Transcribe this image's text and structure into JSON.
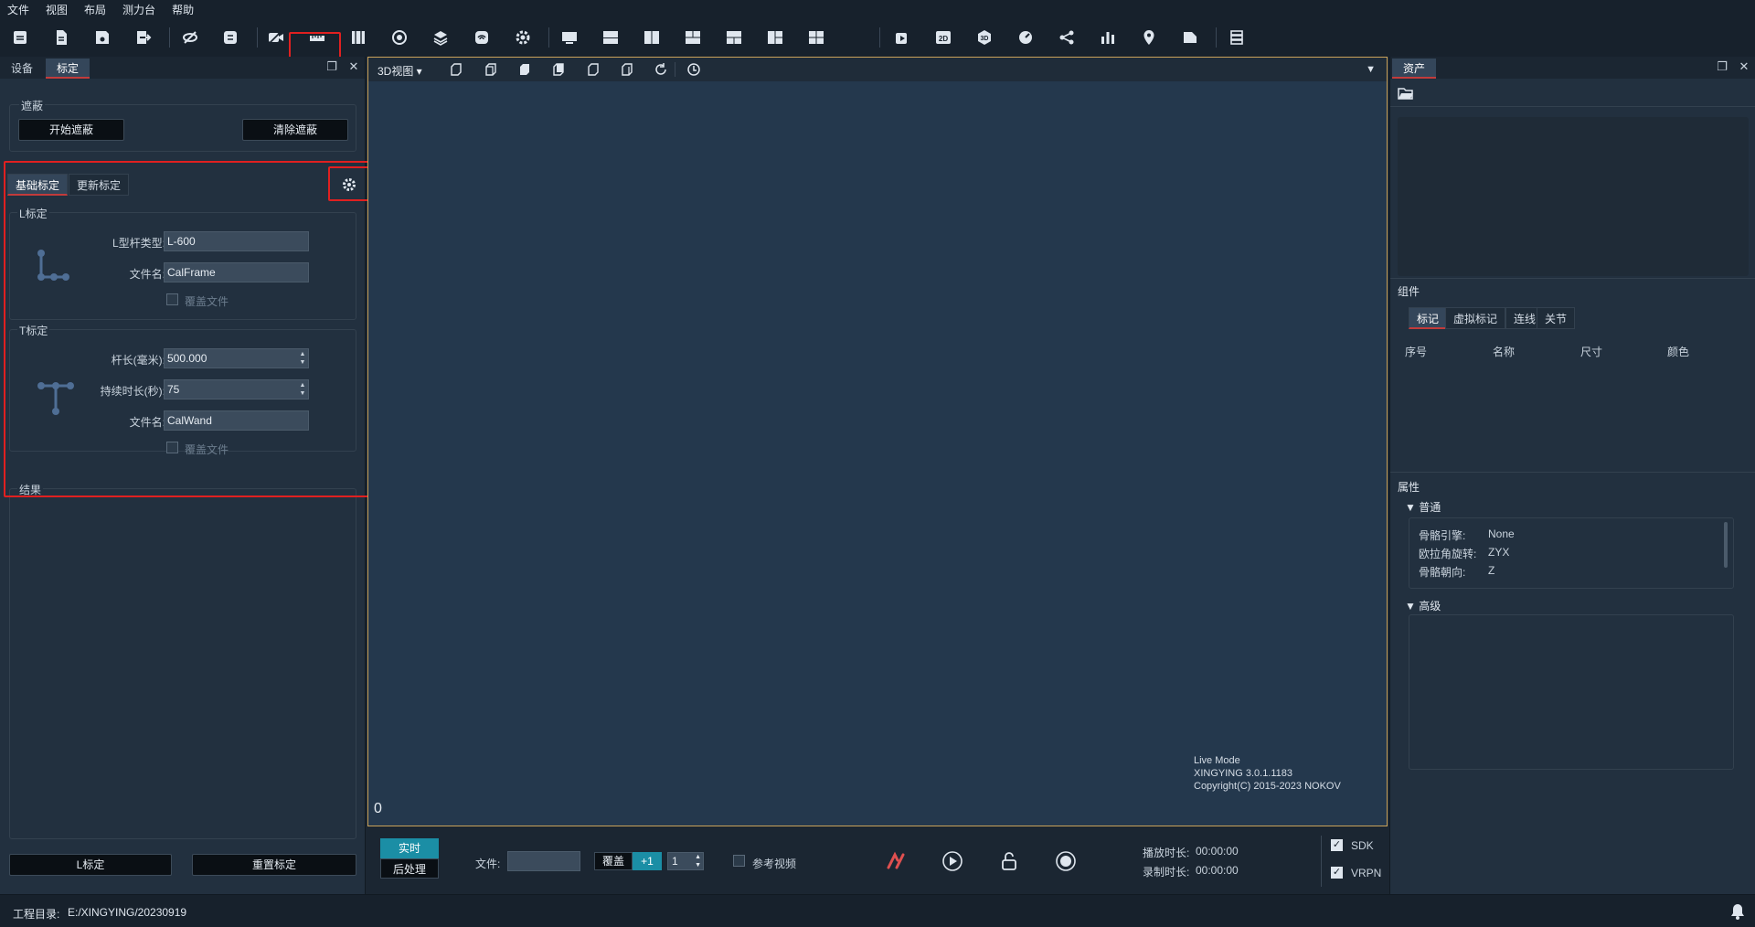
{
  "menu": [
    "文件",
    "视图",
    "布局",
    "测力台",
    "帮助"
  ],
  "toolbar_icons": [
    "open-project-icon",
    "new-file-icon",
    "save-icon",
    "export-icon",
    "hide-icon",
    "sync-icon",
    "camera-off-icon",
    "ruler-icon",
    "film-icon",
    "record-disc-icon",
    "layers-icon",
    "wireless-icon",
    "settings-icon",
    "monitor-icon",
    "layout-1-icon",
    "layout-2-icon",
    "layout-3-icon",
    "layout-4-icon",
    "layout-5-icon",
    "layout-6-icon",
    "camera-2d-icon",
    "2d-view-icon",
    "3d-view-icon",
    "gauge-icon",
    "skeleton-icon",
    "bar-chart-icon",
    "location-pin-icon",
    "document-icon",
    "list-icon"
  ],
  "left_panel": {
    "tabs": [
      "设备",
      "标定"
    ],
    "active_tab": "标定",
    "mask_group": {
      "title": "遮蔽",
      "start_button": "开始遮蔽",
      "clear_button": "清除遮蔽"
    },
    "subtabs": [
      "基础标定",
      "更新标定"
    ],
    "l_calib": {
      "title": "L标定",
      "type_label": "L型杆类型:",
      "type_value": "L-600",
      "filename_label": "文件名:",
      "filename_value": "CalFrame",
      "overwrite_label": "覆盖文件"
    },
    "t_calib": {
      "title": "T标定",
      "length_label": "杆长(毫米):",
      "length_value": "500.000",
      "duration_label": "持续时长(秒):",
      "duration_value": "75",
      "filename_label": "文件名:",
      "filename_value": "CalWand",
      "overwrite_label": "覆盖文件"
    },
    "result_title": "结果",
    "l_calib_button": "L标定",
    "reset_button": "重置标定"
  },
  "viewport": {
    "view_label": "3D视图",
    "info_line1": "Live Mode",
    "info_line2": "XINGYING 3.0.1.1183",
    "info_line3": "Copyright(C) 2015-2023 NOKOV",
    "frame_counter": "0"
  },
  "transport": {
    "live_button": "实时",
    "post_button": "后处理",
    "file_label": "文件:",
    "overlay_button": "覆盖",
    "plus_button": "+1",
    "step_value": "1",
    "ref_video_label": "参考视频",
    "play_time_label": "播放时长:",
    "play_time_value": "00:00:00",
    "record_time_label": "录制时长:",
    "record_time_value": "00:00:00",
    "sdk_label": "SDK",
    "vrpn_label": "VRPN"
  },
  "right_panel": {
    "tab": "资产",
    "components_title": "组件",
    "component_tabs": [
      "标记",
      "虚拟标记",
      "连线",
      "关节"
    ],
    "columns": [
      "序号",
      "名称",
      "尺寸",
      "颜色"
    ],
    "properties_title": "属性",
    "general_title": "普通",
    "props": [
      {
        "key": "骨骼引擎:",
        "value": "None"
      },
      {
        "key": "欧拉角旋转:",
        "value": "ZYX"
      },
      {
        "key": "骨骼朝向:",
        "value": "Z"
      }
    ],
    "advanced_title": "高级"
  },
  "status": {
    "project_label": "工程目录:",
    "project_path": "E:/XINGYING/20230919"
  },
  "colors": {
    "accent_red": "#e02020",
    "viewport_border": "#c9a25a",
    "live_teal": "#1b8ea5"
  }
}
